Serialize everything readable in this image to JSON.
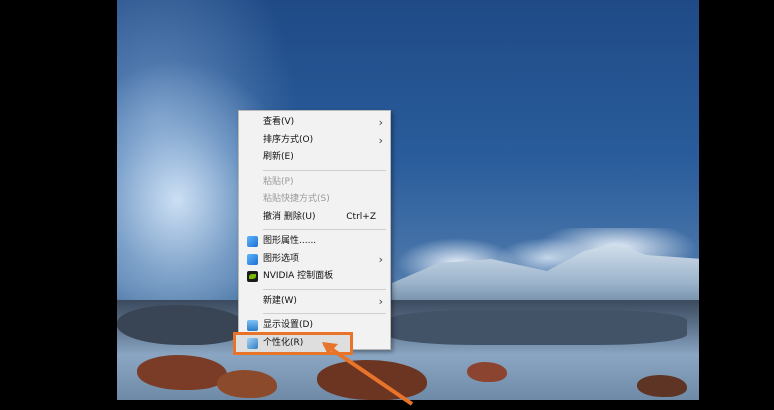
{
  "menu": {
    "items": [
      {
        "label": "查看(V)",
        "submenu": true,
        "disabled": false
      },
      {
        "label": "排序方式(O)",
        "submenu": true,
        "disabled": false
      },
      {
        "label": "刷新(E)",
        "submenu": false,
        "disabled": false
      },
      {
        "label": "粘贴(P)",
        "submenu": false,
        "disabled": true
      },
      {
        "label": "粘贴快捷方式(S)",
        "submenu": false,
        "disabled": true
      },
      {
        "label": "撤消 删除(U)",
        "shortcut": "Ctrl+Z",
        "submenu": false,
        "disabled": false
      },
      {
        "label": "图形属性......",
        "icon": "graphics-icon",
        "submenu": false
      },
      {
        "label": "图形选项",
        "icon": "graphics-icon",
        "submenu": true
      },
      {
        "label": "NVIDIA 控制面板",
        "icon": "nvidia-icon",
        "submenu": false
      },
      {
        "label": "新建(W)",
        "submenu": true
      },
      {
        "label": "显示设置(D)",
        "icon": "display-settings-icon",
        "submenu": false
      },
      {
        "label": "个性化(R)",
        "icon": "personalize-icon",
        "submenu": false,
        "highlighted": true
      }
    ]
  },
  "colors": {
    "highlight_outline": "#e8742a",
    "menu_background": "#f2f2f2"
  }
}
